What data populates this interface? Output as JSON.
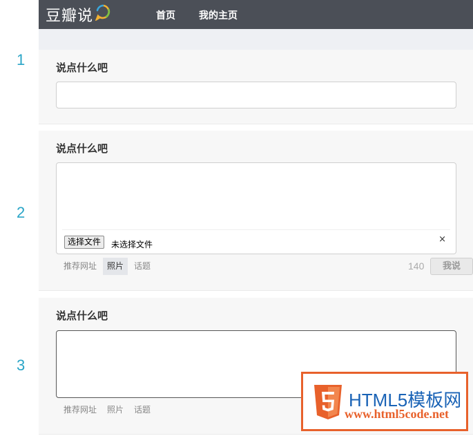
{
  "app": {
    "logo_text": "豆瓣说",
    "nav": [
      "首页",
      "我的主页"
    ]
  },
  "step_numbers": [
    "1",
    "2",
    "3"
  ],
  "sections": [
    {
      "title": "说点什么吧"
    },
    {
      "title": "说点什么吧",
      "file_button": "选择文件",
      "file_status": "未选择文件",
      "close": "×",
      "tools": [
        "推荐网址",
        "照片",
        "话题"
      ],
      "active_tool": "照片",
      "counter": "140",
      "submit": "我说"
    },
    {
      "title": "说点什么吧",
      "tools": [
        "推荐网址",
        "照片",
        "话题"
      ]
    }
  ],
  "watermark": {
    "line1": "HTML5模板网",
    "line2": "www.html5code.net"
  },
  "colors": {
    "topbar": "#4b4f57",
    "step_number": "#2aa5c7",
    "watermark_orange": "#e8612b",
    "watermark_blue": "#1a63b6"
  }
}
